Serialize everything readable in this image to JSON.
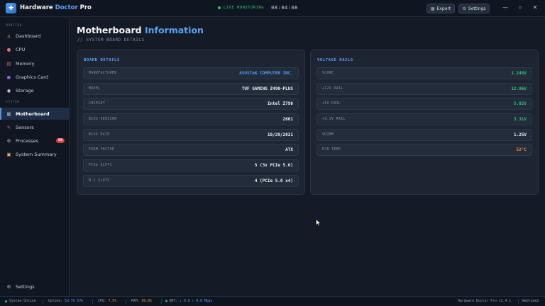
{
  "app": {
    "title_main": "Hardware ",
    "title_accent": "Doctor",
    "title_tail": " Pro",
    "logo_icon": "stethoscope-icon"
  },
  "header": {
    "live_label": "LIVE MONITORING",
    "clock": "08:04:08",
    "export_label": "Export",
    "settings_label": "Settings",
    "minimize": "—",
    "maximize": "▫",
    "close": "✕"
  },
  "sidebar": {
    "section_monitor": "MONITOR",
    "section_system": "SYSTEM",
    "items": [
      {
        "label": "Dashboard",
        "icon": "home-icon",
        "glyph": "⌂",
        "color": "#e0a54a"
      },
      {
        "label": "CPU",
        "icon": "chip-icon",
        "glyph": "●",
        "color": "#e06a8a"
      },
      {
        "label": "Memory",
        "icon": "memory-icon",
        "glyph": "▤",
        "color": "#e05a6a"
      },
      {
        "label": "Graphics Card",
        "icon": "gpu-icon",
        "glyph": "◼",
        "color": "#8a6ae0"
      },
      {
        "label": "Storage",
        "icon": "disk-icon",
        "glyph": "◉",
        "color": "#d9dde4"
      },
      {
        "label": "Motherboard",
        "icon": "motherboard-icon",
        "glyph": "▦",
        "color": "#9fb4d2"
      },
      {
        "label": "Sensors",
        "icon": "thermometer-icon",
        "glyph": "✎",
        "color": "#e05a6a"
      },
      {
        "label": "Processes",
        "icon": "gear-icon",
        "glyph": "⚙",
        "color": "#b8c2cf",
        "badge": "58"
      },
      {
        "label": "System Summary",
        "icon": "clipboard-icon",
        "glyph": "▣",
        "color": "#d8b36a"
      }
    ],
    "settings_label": "Settings",
    "settings_icon": "gear-icon"
  },
  "main": {
    "title_main": "Motherboard ",
    "title_accent": "Information",
    "subtitle": "// SYSTEM BOARD DETAILS"
  },
  "board": {
    "title": "BOARD DETAILS",
    "rows": [
      {
        "label": "MANUFACTURER",
        "value": "ASUSTeK COMPUTER INC."
      },
      {
        "label": "MODEL",
        "value": "TUF GAMING Z490-PLUS"
      },
      {
        "label": "CHIPSET",
        "value": "Intel Z790"
      },
      {
        "label": "BIOS VERSION",
        "value": "2601"
      },
      {
        "label": "BIOS DATE",
        "value": "10/29/2021"
      },
      {
        "label": "FORM FACTOR",
        "value": "ATX"
      },
      {
        "label": "PCIe SLOTS",
        "value": "5 (3x PCIe 5.0)"
      },
      {
        "label": "M.2 SLOTS",
        "value": "4 (PCIe 5.0 x4)"
      }
    ]
  },
  "voltage": {
    "title": "VOLTAGE RAILS",
    "rows": [
      {
        "label": "VCORE",
        "value": "1.248V"
      },
      {
        "label": "+12V RAIL",
        "value": "12.06V"
      },
      {
        "label": "+5V RAIL",
        "value": "5.02V"
      },
      {
        "label": "+3.3V RAIL",
        "value": "3.31V"
      },
      {
        "label": "VDIMM",
        "value": "1.25V"
      },
      {
        "label": "PCH TEMP",
        "value": "52°C"
      }
    ]
  },
  "status": {
    "online": "System Online",
    "uptime_label": "Uptime:",
    "uptime_value": "5d 7h 57m",
    "cpu_label": "CPU:",
    "cpu_value": "7.5%",
    "ram_label": "RAM:",
    "ram_value": "90.8%",
    "net_label": "NET:",
    "net_value": "↓ 0.0 ↑ 0.0 Mbps",
    "version": "Hardware Doctor Pro v2.4.1",
    "user": "Webtime2"
  },
  "colors": {
    "accent": "#5aa2f5",
    "online": "#27c66a",
    "warning": "#f08a2a",
    "badge": "#d94040"
  }
}
